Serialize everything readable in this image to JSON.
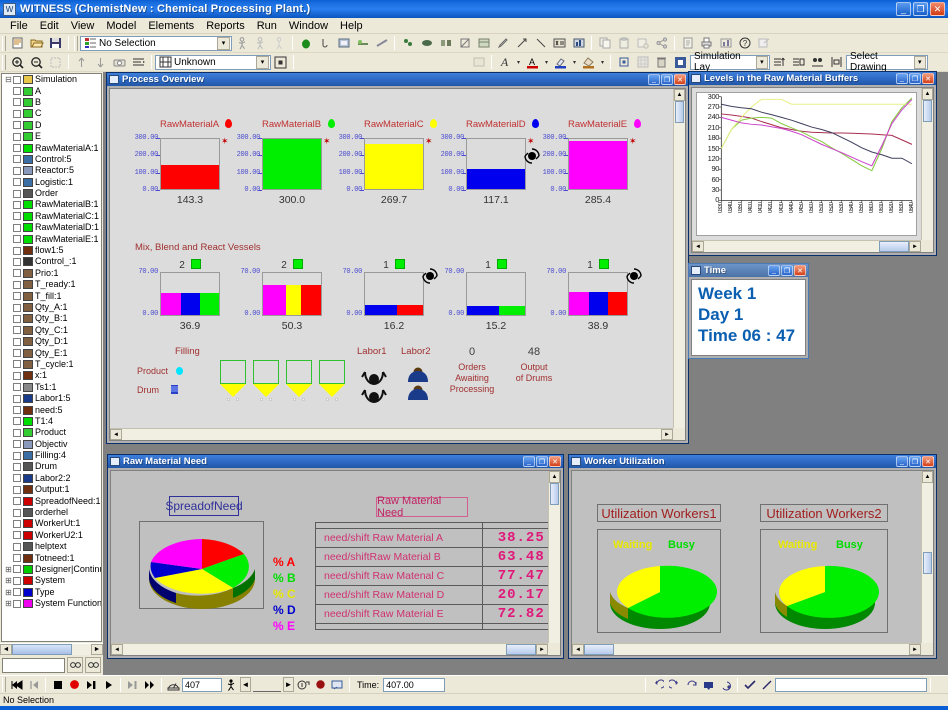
{
  "window": {
    "title": "WITNESS (ChemistNew : Chemical Processing Plant.)",
    "minimize": "_",
    "maximize": "□",
    "close": "×"
  },
  "menu": [
    "File",
    "Edit",
    "View",
    "Model",
    "Elements",
    "Reports",
    "Run",
    "Window",
    "Help"
  ],
  "toolbar": {
    "selection_combo": "No Selection",
    "unknown_combo": "Unknown",
    "layer_combo": "Simulation Lay",
    "drawing_combo": "Select Drawing"
  },
  "tree": {
    "root": "Simulation",
    "items": [
      {
        "label": "A",
        "icon": "drop-icon",
        "color": "#33cc33"
      },
      {
        "label": "B",
        "icon": "drop-icon",
        "color": "#33cc33"
      },
      {
        "label": "C",
        "icon": "drop-icon",
        "color": "#33cc33"
      },
      {
        "label": "D",
        "icon": "drop-icon",
        "color": "#33cc33"
      },
      {
        "label": "E",
        "icon": "drop-icon",
        "color": "#33cc33"
      },
      {
        "label": "RawMaterialA:1",
        "icon": "buffer-icon",
        "color": "#00dd00"
      },
      {
        "label": "Control:5",
        "icon": "machine-icon",
        "color": "#3a6ea5"
      },
      {
        "label": "Reactor:5",
        "icon": "machine-icon",
        "color": "#8899bb"
      },
      {
        "label": "Logistic:1",
        "icon": "machine-icon",
        "color": "#3a6ea5"
      },
      {
        "label": "Order",
        "icon": "part-icon",
        "color": "#555555"
      },
      {
        "label": "RawMaterialB:1",
        "icon": "buffer-icon",
        "color": "#00dd00"
      },
      {
        "label": "RawMaterialC:1",
        "icon": "buffer-icon",
        "color": "#00dd00"
      },
      {
        "label": "RawMaterialD:1",
        "icon": "buffer-icon",
        "color": "#00dd00"
      },
      {
        "label": "RawMaterialE:1",
        "icon": "buffer-icon",
        "color": "#00dd00"
      },
      {
        "label": "flow1:5",
        "icon": "var-icon",
        "color": "#703010"
      },
      {
        "label": "Control_:1",
        "icon": "attr-icon",
        "color": "#333333"
      },
      {
        "label": "Prio:1",
        "icon": "var-icon",
        "color": "#806040"
      },
      {
        "label": "T_ready:1",
        "icon": "var-icon",
        "color": "#806040"
      },
      {
        "label": "T_fill:1",
        "icon": "var-icon",
        "color": "#806040"
      },
      {
        "label": "Qty_A:1",
        "icon": "var-icon",
        "color": "#806040"
      },
      {
        "label": "Qty_B:1",
        "icon": "var-icon",
        "color": "#806040"
      },
      {
        "label": "Qty_C:1",
        "icon": "var-icon",
        "color": "#806040"
      },
      {
        "label": "Qty_D:1",
        "icon": "var-icon",
        "color": "#806040"
      },
      {
        "label": "Qty_E:1",
        "icon": "var-icon",
        "color": "#806040"
      },
      {
        "label": "T_cycle:1",
        "icon": "var-icon",
        "color": "#806040"
      },
      {
        "label": "x:1",
        "icon": "var-icon",
        "color": "#703010"
      },
      {
        "label": "Ts1:1",
        "icon": "dist-icon",
        "color": "#888888"
      },
      {
        "label": "Labor1:5",
        "icon": "labor-icon",
        "color": "#1a3a8a"
      },
      {
        "label": "need:5",
        "icon": "var-icon",
        "color": "#703010"
      },
      {
        "label": "T1:4",
        "icon": "buffer-icon",
        "color": "#00dd00"
      },
      {
        "label": "Product",
        "icon": "drop-icon",
        "color": "#33cc33"
      },
      {
        "label": "Objectiv",
        "icon": "machine-icon",
        "color": "#8899bb"
      },
      {
        "label": "Filling:4",
        "icon": "machine-icon",
        "color": "#3a6ea5"
      },
      {
        "label": "Drum",
        "icon": "part-icon",
        "color": "#555555"
      },
      {
        "label": "Labor2:2",
        "icon": "labor-icon",
        "color": "#1a3a8a"
      },
      {
        "label": "Output:1",
        "icon": "var-icon",
        "color": "#703010"
      },
      {
        "label": "SpreadofNeed:1",
        "icon": "pie-icon",
        "color": "#cc0000"
      },
      {
        "label": "orderhel",
        "icon": "part-icon",
        "color": "#555555"
      },
      {
        "label": "WorkerUt:1",
        "icon": "pie-icon",
        "color": "#cc0000"
      },
      {
        "label": "WorkerU2:1",
        "icon": "pie-icon",
        "color": "#cc0000"
      },
      {
        "label": "helptext",
        "icon": "part-icon",
        "color": "#555555"
      },
      {
        "label": "Totneed:1",
        "icon": "var-icon",
        "color": "#703010"
      }
    ],
    "groups": [
      {
        "label": "Designer|Continuous",
        "color": "#00cc00"
      },
      {
        "label": "System",
        "color": "#cc0000"
      },
      {
        "label": "Type",
        "color": "#0000cc"
      },
      {
        "label": "System Functions",
        "color": "#ee00ee"
      }
    ]
  },
  "process_overview": {
    "title": "Process Overview",
    "buffers_section": "",
    "vessels_section": "Mix, Blend and React Vessels",
    "buffers": [
      {
        "name": "RawMaterialA",
        "color": "#ff0000",
        "value": "143.3",
        "level": 143.3,
        "max": 300
      },
      {
        "name": "RawMaterialB",
        "color": "#00ee00",
        "value": "300.0",
        "level": 300.0,
        "max": 300
      },
      {
        "name": "RawMaterialC",
        "color": "#ffff00",
        "value": "269.7",
        "level": 269.7,
        "max": 300
      },
      {
        "name": "RawMaterialD",
        "color": "#0000ee",
        "value": "117.1",
        "level": 117.1,
        "max": 300,
        "stirrer": true
      },
      {
        "name": "RawMaterialE",
        "color": "#ff00ff",
        "value": "285.4",
        "level": 285.4,
        "max": 300
      }
    ],
    "buffer_axis": [
      "300.00",
      "200.00",
      "100.00",
      "0.00"
    ],
    "vessel_axis": [
      "70.00",
      "0.00"
    ],
    "vessels": [
      {
        "count": "2",
        "value": "36.9",
        "total": 36.9,
        "max": 70,
        "stirrer": false,
        "segments": [
          {
            "color": "#ff00ff",
            "w": 0.34
          },
          {
            "color": "#0000ee",
            "w": 0.33
          },
          {
            "color": "#00ee00",
            "w": 0.33
          }
        ]
      },
      {
        "count": "2",
        "value": "50.3",
        "total": 50.3,
        "max": 70,
        "stirrer": false,
        "segments": [
          {
            "color": "#ff00ff",
            "w": 0.4
          },
          {
            "color": "#ffff00",
            "w": 0.25
          },
          {
            "color": "#ff0000",
            "w": 0.35
          }
        ]
      },
      {
        "count": "1",
        "value": "16.2",
        "total": 16.2,
        "max": 70,
        "stirrer": true,
        "segments": [
          {
            "color": "#0000ee",
            "w": 0.55
          },
          {
            "color": "#ff0000",
            "w": 0.45
          }
        ]
      },
      {
        "count": "1",
        "value": "15.2",
        "total": 15.2,
        "max": 70,
        "stirrer": false,
        "segments": [
          {
            "color": "#0000ee",
            "w": 0.55
          },
          {
            "color": "#00ee00",
            "w": 0.45
          }
        ]
      },
      {
        "count": "1",
        "value": "38.9",
        "total": 38.9,
        "max": 70,
        "stirrer": true,
        "segments": [
          {
            "color": "#ff00ff",
            "w": 0.34
          },
          {
            "color": "#0000ee",
            "w": 0.33
          },
          {
            "color": "#ff0000",
            "w": 0.33
          }
        ]
      }
    ],
    "filling": {
      "title": "Filling",
      "product_label": "Product",
      "drum_label": "Drum",
      "stations": 4
    },
    "labor1_label": "Labor1",
    "labor2_label": "Labor2",
    "orders_value": "0",
    "orders_label": "Orders\nAwaiting\nProcessing",
    "orders_label_lines": [
      "Orders",
      "Awaiting",
      "Processing"
    ],
    "output_value": "48",
    "output_label_lines": [
      "Output",
      "of Drums"
    ]
  },
  "levels_chart": {
    "title": "Levels in the Raw Material Buffers"
  },
  "chart_data": [
    {
      "type": "line",
      "title": "Levels in the Raw Material Buffers",
      "xlabel": "",
      "ylabel": "",
      "ylim": [
        0,
        300
      ],
      "yticks": [
        0,
        30,
        60,
        90,
        120,
        150,
        180,
        210,
        240,
        270,
        300
      ],
      "grid": false,
      "legend": "none",
      "x": [
        "03:30",
        "03:40",
        "03:50",
        "04:00",
        "04:10",
        "04:20",
        "04:30",
        "04:40",
        "04:50",
        "05:00",
        "05:10",
        "05:20",
        "05:30",
        "05:40",
        "05:50",
        "06:00",
        "06:10",
        "06:20",
        "06:30",
        "06:40"
      ],
      "series": [
        {
          "name": "RawMaterialA",
          "color": "#a83050",
          "values": [
            250,
            247,
            243,
            238,
            228,
            219,
            210,
            205,
            200,
            197,
            196,
            195,
            195,
            194,
            193,
            192,
            190,
            188,
            175,
            162
          ]
        },
        {
          "name": "RawMaterialB",
          "color": "#88cc44",
          "values": [
            150,
            205,
            232,
            238,
            240,
            238,
            222,
            210,
            198,
            183,
            170,
            152,
            136,
            118,
            100,
            86,
            150,
            228,
            268,
            296
          ]
        },
        {
          "name": "RawMaterialC",
          "color": "#e8f088",
          "values": [
            150,
            205,
            240,
            270,
            292,
            292,
            292,
            278,
            278,
            278,
            278,
            278,
            278,
            278,
            278,
            278,
            278,
            278,
            278,
            278
          ]
        },
        {
          "name": "RawMaterialD",
          "color": "#404060",
          "values": [
            278,
            272,
            268,
            265,
            255,
            248,
            240,
            232,
            222,
            212,
            205,
            196,
            182,
            168,
            152,
            140,
            132,
            122,
            122,
            106
          ]
        },
        {
          "name": "RawMaterialE",
          "color": "#cc44cc",
          "values": [
            240,
            232,
            224,
            220,
            218,
            213,
            208,
            200,
            190,
            176,
            162,
            150,
            138,
            125,
            112,
            100,
            158,
            222,
            262,
            292
          ]
        }
      ]
    },
    {
      "type": "pie",
      "title": "SpreadofNeed",
      "labels": [
        "% A",
        "% B",
        "% C",
        "% D",
        "% E"
      ],
      "colors": [
        "#ff0000",
        "#00ee00",
        "#ffff00",
        "#0000cc",
        "#ff00ff"
      ],
      "values": [
        38.25,
        63.48,
        77.47,
        20.17,
        72.82
      ]
    },
    {
      "type": "pie",
      "title": "Utilization Workers1",
      "labels": [
        "Waiting",
        "Busy"
      ],
      "colors": [
        "#ffff00",
        "#00ee00"
      ],
      "values": [
        22,
        78
      ]
    },
    {
      "type": "pie",
      "title": "Utilization Workers2",
      "labels": [
        "Waiting",
        "Busy"
      ],
      "colors": [
        "#ffff00",
        "#00ee00"
      ],
      "values": [
        33,
        67
      ]
    }
  ],
  "time_window": {
    "title": "Time",
    "week": "Week  1",
    "day": "Day   1",
    "time": "Time  06 : 47"
  },
  "raw_material_need": {
    "title": "Raw Material Need",
    "pie_title": "SpreadofNeed",
    "table_title": "Raw Material Need",
    "legend": [
      "% A",
      "% B",
      "% C",
      "% D",
      "% E"
    ],
    "rows": [
      {
        "label": "need/shift Raw Material A",
        "value": "38.25"
      },
      {
        "label": "need/shiftRaw Material B",
        "value": "63.48"
      },
      {
        "label": "need/shift Raw Matenal C",
        "value": "77.47"
      },
      {
        "label": "need/shift Raw Matenal D",
        "value": "20.17"
      },
      {
        "label": "need/shift Raw Material E",
        "value": "72.82"
      }
    ]
  },
  "worker_utilization": {
    "title": "Worker Utilization",
    "panels": [
      {
        "title": "Utilization Workers1",
        "waiting": "Waiting",
        "busy": "Busy"
      },
      {
        "title": "Utilization Workers2",
        "waiting": "Waiting",
        "busy": "Busy"
      }
    ]
  },
  "bottom_bar": {
    "speed_value": "407",
    "time_label": "Time:",
    "time_value": "407.00",
    "command_value": ""
  },
  "status_bar": {
    "text": "No Selection"
  }
}
